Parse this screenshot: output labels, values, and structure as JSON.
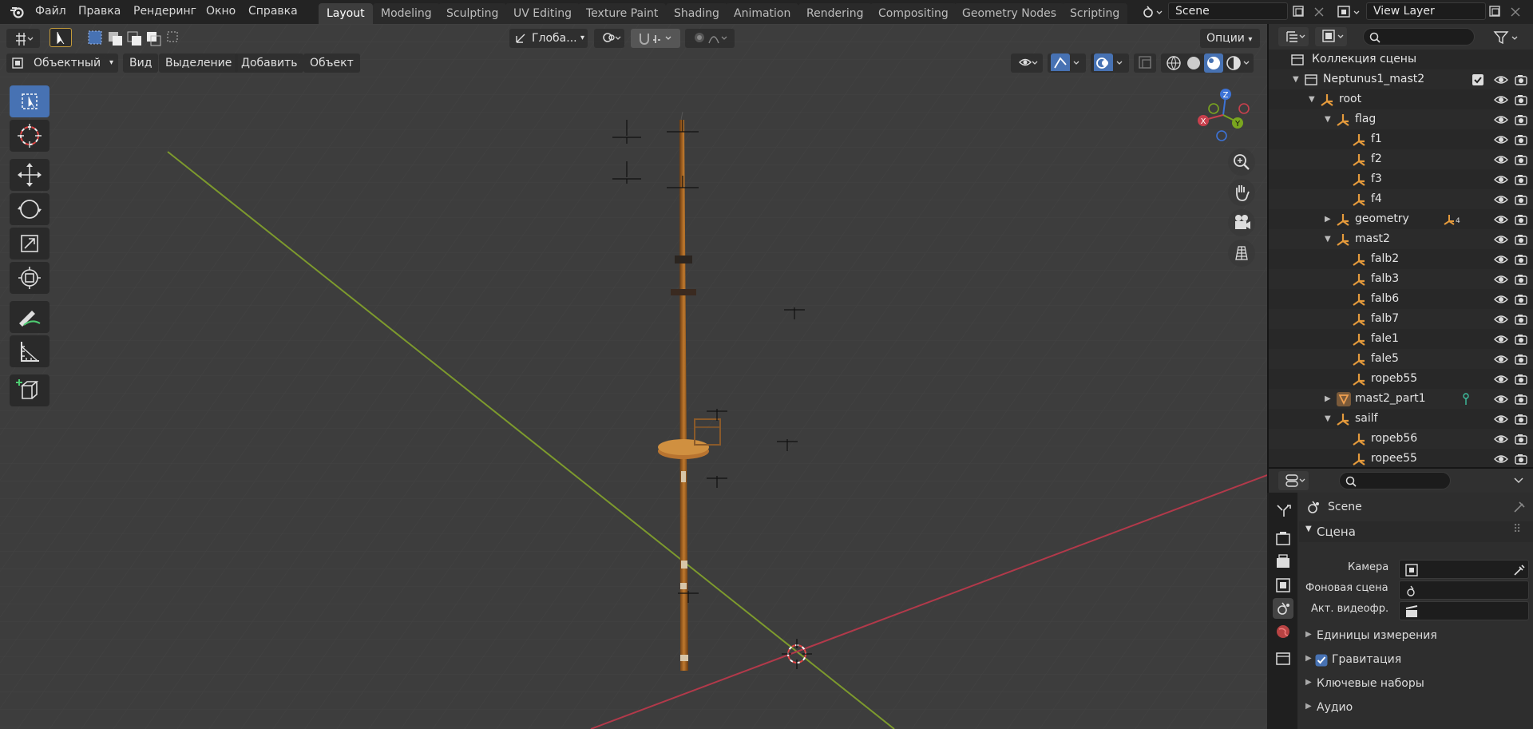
{
  "topbar": {
    "menus": [
      "Файл",
      "Правка",
      "Рендеринг",
      "Окно",
      "Справка"
    ],
    "workspaces": [
      "Layout",
      "Modeling",
      "Sculpting",
      "UV Editing",
      "Texture Paint",
      "Shading",
      "Animation",
      "Rendering",
      "Compositing",
      "Geometry Nodes",
      "Scripting"
    ],
    "active_workspace": "Layout",
    "scene_name": "Scene",
    "view_layer": "View Layer"
  },
  "toolbar": {
    "orientation": "Глоба...",
    "options": "Опции"
  },
  "viewport_header": {
    "mode": "Объектный",
    "menus": [
      "Вид",
      "Выделение",
      "Добавить",
      "Объект"
    ]
  },
  "gizmo": {
    "x": "X",
    "y": "Y",
    "z": "Z"
  },
  "outliner": {
    "scene_collection": "Коллекция сцены",
    "rows": [
      {
        "label": "Neptunus1_mast2",
        "type": "collection",
        "expanded": true,
        "checked": true
      },
      {
        "label": "root",
        "type": "empty",
        "expanded": true
      },
      {
        "label": "flag",
        "type": "empty",
        "expanded": true
      },
      {
        "label": "f1",
        "type": "empty"
      },
      {
        "label": "f2",
        "type": "empty"
      },
      {
        "label": "f3",
        "type": "empty"
      },
      {
        "label": "f4",
        "type": "empty"
      },
      {
        "label": "geometry",
        "type": "empty",
        "expanded": false,
        "child_count": "4"
      },
      {
        "label": "mast2",
        "type": "empty",
        "expanded": true
      },
      {
        "label": "falb2",
        "type": "empty"
      },
      {
        "label": "falb3",
        "type": "empty"
      },
      {
        "label": "falb6",
        "type": "empty"
      },
      {
        "label": "falb7",
        "type": "empty"
      },
      {
        "label": "fale1",
        "type": "empty"
      },
      {
        "label": "fale5",
        "type": "empty"
      },
      {
        "label": "ropeb55",
        "type": "empty"
      },
      {
        "label": "mast2_part1",
        "type": "mesh",
        "expanded": false
      },
      {
        "label": "sailf",
        "type": "empty",
        "expanded": true
      },
      {
        "label": "ropeb56",
        "type": "empty"
      },
      {
        "label": "ropee55",
        "type": "empty"
      }
    ]
  },
  "properties": {
    "context": "Scene",
    "section_scene": "Сцена",
    "camera_label": "Камера",
    "bg_scene_label": "Фоновая сцена",
    "clip_label": "Акт. видеофр.",
    "sections": [
      "Единицы измерения",
      "Гравитация",
      "Ключевые наборы",
      "Аудио"
    ],
    "gravity_checked": true
  },
  "colors": {
    "accent": "#4772b3",
    "x_axis": "#c9404d",
    "y_axis": "#7aa61f",
    "z_axis": "#3d73d6",
    "empty_icon": "#e49a3c"
  }
}
